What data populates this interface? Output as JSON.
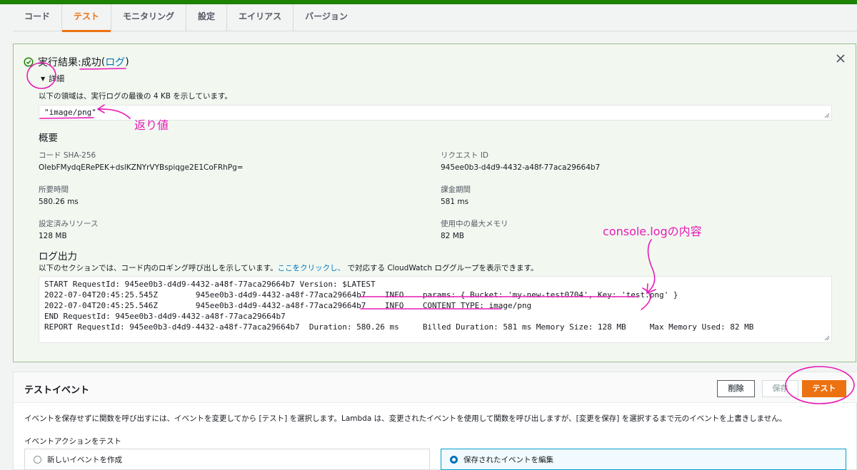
{
  "tabs": [
    "コード",
    "テスト",
    "モニタリング",
    "設定",
    "エイリアス",
    "バージョン"
  ],
  "result": {
    "prefix": "実行結果: ",
    "status": "成功",
    "open_paren": " (",
    "log_link": "ログ",
    "close_paren": ")",
    "details_label": "詳細",
    "details_desc": "以下の領域は、実行ログの最後の 4 KB を示しています。",
    "return_value": "\"image/png\"",
    "summary_heading": "概要",
    "code_sha_label": "コード SHA-256",
    "code_sha_value": "OIebFMydqERePEK+dslKZNYrVYBspiqge2E1CoFRhPg=",
    "request_id_label": "リクエスト ID",
    "request_id_value": "945ee0b3-d4d9-4432-a48f-77aca29664b7",
    "duration_label": "所要時間",
    "duration_value": "580.26 ms",
    "billed_label": "課金期間",
    "billed_value": "581 ms",
    "resources_label": "設定済みリソース",
    "resources_value": "128 MB",
    "max_mem_label": "使用中の最大メモリ",
    "max_mem_value": "82 MB",
    "log_heading": "ログ出力",
    "log_desc_before": "以下のセクションでは、コード内のロギング呼び出しを示しています。",
    "log_desc_link": "ここをクリックし、",
    "log_desc_after": "で対応する CloudWatch ロググループを表示できます。",
    "log_lines": [
      "START RequestId: 945ee0b3-d4d9-4432-a48f-77aca29664b7 Version: $LATEST",
      "2022-07-04T20:45:25.545Z\t945ee0b3-d4d9-4432-a48f-77aca29664b7\tINFO\tparams: { Bucket: 'my-new-test0704', Key: 'test.png' }",
      "2022-07-04T20:45:25.546Z\t945ee0b3-d4d9-4432-a48f-77aca29664b7\tINFO\tCONTENT TYPE: image/png",
      "END RequestId: 945ee0b3-d4d9-4432-a48f-77aca29664b7",
      "REPORT RequestId: 945ee0b3-d4d9-4432-a48f-77aca29664b7\tDuration: 580.26 ms\tBilled Duration: 581 ms\tMemory Size: 128 MB\tMax Memory Used: 82 MB"
    ]
  },
  "annotations": {
    "return_value": "返り値",
    "console_log": "console.logの内容",
    "color": "#e81ab7"
  },
  "test_event": {
    "title": "テストイベント",
    "delete_label": "削除",
    "save_label": "保存",
    "test_label": "テスト",
    "desc": "イベントを保存せずに関数を呼び出すには、イベントを変更してから [テスト] を選択します。Lambda は、変更されたイベントを使用して関数を呼び出しますが、[変更を保存] を選択するまで元のイベントを上書きしません。",
    "action_label": "イベントアクションをテスト",
    "option_new": "新しいイベントを作成",
    "option_edit": "保存されたイベントを編集"
  },
  "colors": {
    "accent": "#ec7211",
    "success": "#1d8102",
    "link": "#0073bb"
  }
}
